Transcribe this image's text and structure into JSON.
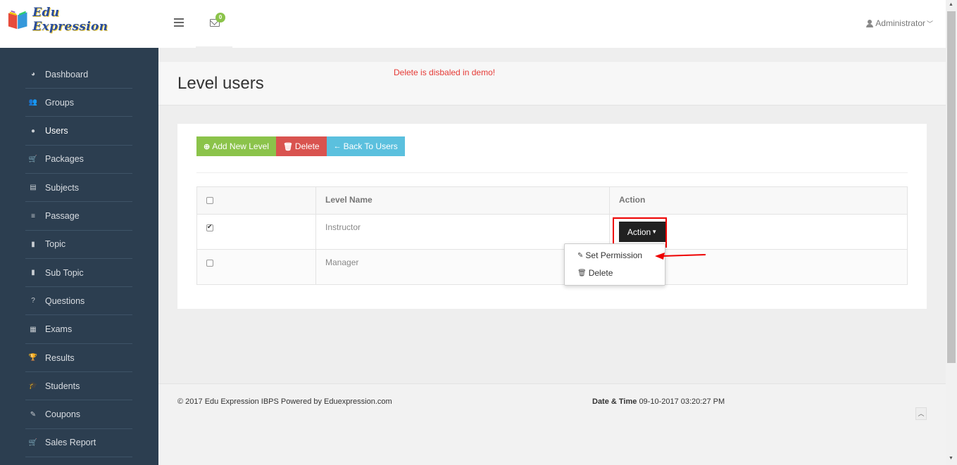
{
  "brand": {
    "name": "Edu Expression"
  },
  "header": {
    "notification_count": "0",
    "user_label": "Administrator"
  },
  "sidebar": {
    "items": [
      {
        "label": "Dashboard",
        "icon": "dashboard-icon",
        "glyph": "◕"
      },
      {
        "label": "Groups",
        "icon": "users-icon",
        "glyph": "👥"
      },
      {
        "label": "Users",
        "icon": "user-icon",
        "glyph": "●"
      },
      {
        "label": "Packages",
        "icon": "cart-icon",
        "glyph": "🛒"
      },
      {
        "label": "Subjects",
        "icon": "book-icon",
        "glyph": "▤"
      },
      {
        "label": "Passage",
        "icon": "bars-icon",
        "glyph": "≡"
      },
      {
        "label": "Topic",
        "icon": "file-icon",
        "glyph": "▮"
      },
      {
        "label": "Sub Topic",
        "icon": "file-icon",
        "glyph": "▮"
      },
      {
        "label": "Questions",
        "icon": "question-icon",
        "glyph": "?"
      },
      {
        "label": "Exams",
        "icon": "list-icon",
        "glyph": "▦"
      },
      {
        "label": "Results",
        "icon": "trophy-icon",
        "glyph": "🏆"
      },
      {
        "label": "Students",
        "icon": "graduation-cap-icon",
        "glyph": "🎓"
      },
      {
        "label": "Coupons",
        "icon": "magic-wand-icon",
        "glyph": "✎"
      },
      {
        "label": "Sales Report",
        "icon": "cart-icon",
        "glyph": "🛒"
      }
    ],
    "active_index": 2
  },
  "page": {
    "title": "Level users",
    "demo_message": "Delete is disbaled in demo!"
  },
  "toolbar": {
    "add_label": "Add New Level",
    "delete_label": "Delete",
    "back_label": "Back To Users"
  },
  "table": {
    "headers": [
      "",
      "Level Name",
      "Action"
    ],
    "rows": [
      {
        "name": "Instructor",
        "checked": true
      },
      {
        "name": "Manager",
        "checked": false
      }
    ]
  },
  "action_menu": {
    "button_label": "Action",
    "items": [
      "Set Permission",
      "Delete"
    ]
  },
  "footer": {
    "copyright": "© 2017 Edu Expression IBPS Powered by Eduexpression.com",
    "datetime_label": "Date & Time",
    "datetime_value": "09-10-2017 03:20:27 PM"
  },
  "colors": {
    "sidebar_bg": "#2c3e50",
    "success": "#8bc34a",
    "danger": "#d9534f",
    "info": "#5bc0de",
    "highlight": "#ee0000"
  }
}
